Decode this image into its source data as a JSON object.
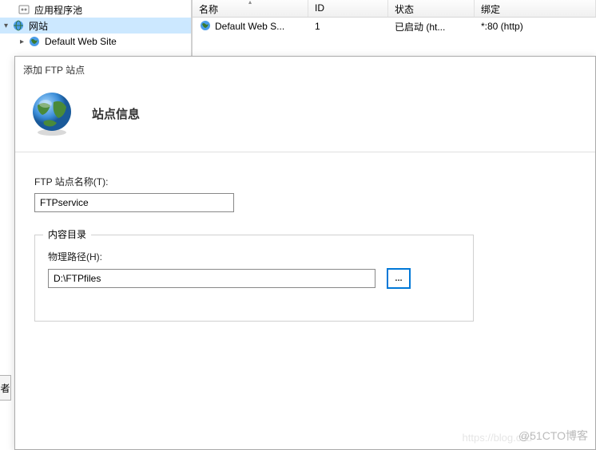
{
  "tree": {
    "app_pools": "应用程序池",
    "sites": "网站",
    "default_site": "Default Web Site"
  },
  "list": {
    "columns": {
      "name": "名称",
      "id": "ID",
      "status": "状态",
      "binding": "绑定"
    },
    "row": {
      "name": "Default Web S...",
      "id": "1",
      "status": "已启动 (ht...",
      "binding": "*:80 (http)"
    }
  },
  "dialog": {
    "title": "添加 FTP 站点",
    "header": "站点信息",
    "site_name_label": "FTP 站点名称(T):",
    "site_name_value": "FTPservice",
    "content_dir_legend": "内容目录",
    "physical_path_label": "物理路径(H):",
    "physical_path_value": "D:\\FTPfiles",
    "browse_button": "..."
  },
  "edge_tab": "者",
  "watermark": "@51CTO博客",
  "watermark2": "https://blog.csd"
}
